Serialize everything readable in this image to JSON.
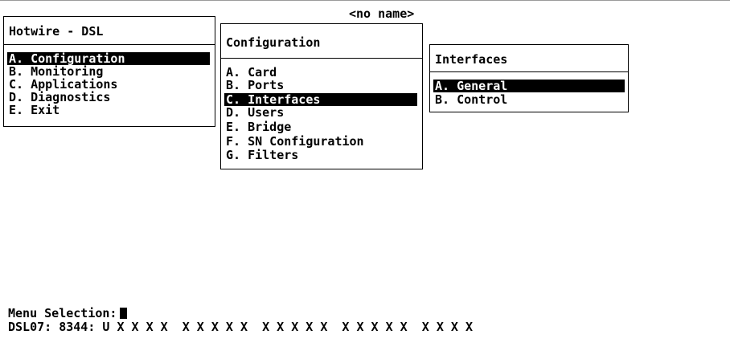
{
  "screen_title": "<no name>",
  "main_menu": {
    "title": "Hotwire - DSL",
    "items": [
      "A. Configuration",
      "B. Monitoring",
      "C. Applications",
      "D. Diagnostics",
      "E. Exit"
    ],
    "selected": "A. Configuration"
  },
  "configuration_menu": {
    "title": "Configuration",
    "items": [
      "A. Card",
      "B. Ports",
      "C. Interfaces",
      "D. Users",
      "E. Bridge",
      "F. SN Configuration",
      "G. Filters"
    ],
    "selected": "C. Interfaces"
  },
  "interfaces_menu": {
    "title": "Interfaces",
    "items": [
      "A. General",
      "B. Control"
    ],
    "selected": "A. General"
  },
  "prompt": {
    "label": "Menu Selection:",
    "value": ""
  },
  "status_line": "DSL07: 8344: U X X X X  X X X X X  X X X X X  X X X X X  X X X X"
}
